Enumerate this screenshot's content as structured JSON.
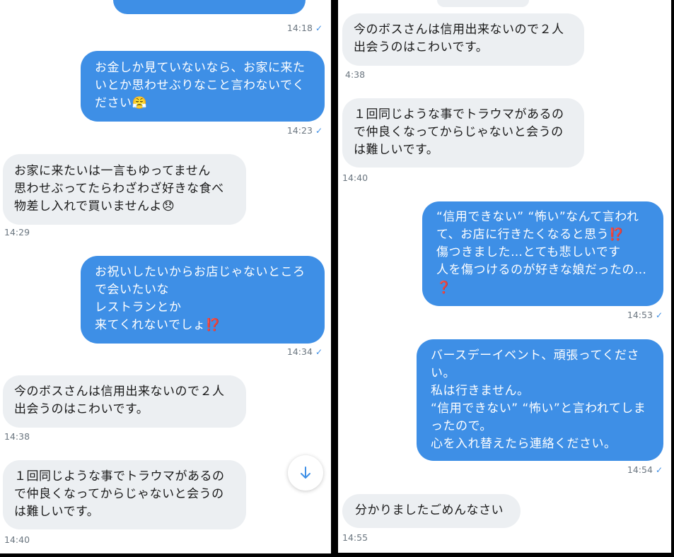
{
  "colors": {
    "outgoing_bubble": "#3e8fe6",
    "incoming_bubble": "#eceff2",
    "read_check": "#3e8fe6",
    "timestamp": "#6b7680"
  },
  "left_panel": {
    "top_timestamp": "14:18",
    "messages": [
      {
        "direction": "outgoing",
        "text": "お金しか見ていないなら、お家に来たいとか思わせぶりなこと言わないでください😤",
        "time": "14:23",
        "read_check": "✓"
      },
      {
        "direction": "incoming",
        "text": "お家に来たいは一言もゆってません\n思わせぶってたらわざわざ好きな食べ物差し入れで買いませんよ😞",
        "time": "14:29"
      },
      {
        "direction": "outgoing",
        "text": "お祝いしたいからお店じゃないところで会いたいな\nレストランとか\n来てくれないでしょ⁉️",
        "time": "14:34",
        "read_check": "✓"
      },
      {
        "direction": "incoming",
        "text": "今のボスさんは信用出来ないので２人出会うのはこわいです。",
        "time": "14:38"
      },
      {
        "direction": "incoming",
        "text": "１回同じような事でトラウマがあるので仲良くなってからじゃないと会うのは難しいです。",
        "time": "14:40"
      }
    ],
    "scroll_down_button": {
      "icon": "arrow-down-icon",
      "glyph": "↓"
    }
  },
  "right_panel": {
    "messages": [
      {
        "direction": "incoming",
        "text": "今のボスさんは信用出来ないので２人出会うのはこわいです。",
        "time": "4:38"
      },
      {
        "direction": "incoming",
        "text": "１回同じような事でトラウマがあるので仲良くなってからじゃないと会うのは難しいです。",
        "time": "14:40"
      },
      {
        "direction": "outgoing",
        "text": "“信用できない” “怖い”なんて言われて、お店に行きたくなると思う⁉️\n傷つきました…とても悲しいです\n人を傷つけるのが好きな娘だったの…❓",
        "time": "14:53",
        "read_check": "✓"
      },
      {
        "direction": "outgoing",
        "text": "バースデーイベント、頑張ってください。\n私は行きません。\n“信用できない” “怖い”と言われてしまったので。\n心を入れ替えたら連絡ください。",
        "time": "14:54",
        "read_check": "✓"
      },
      {
        "direction": "incoming",
        "text": "分かりましたごめんなさい",
        "time": "14:55"
      }
    ]
  }
}
